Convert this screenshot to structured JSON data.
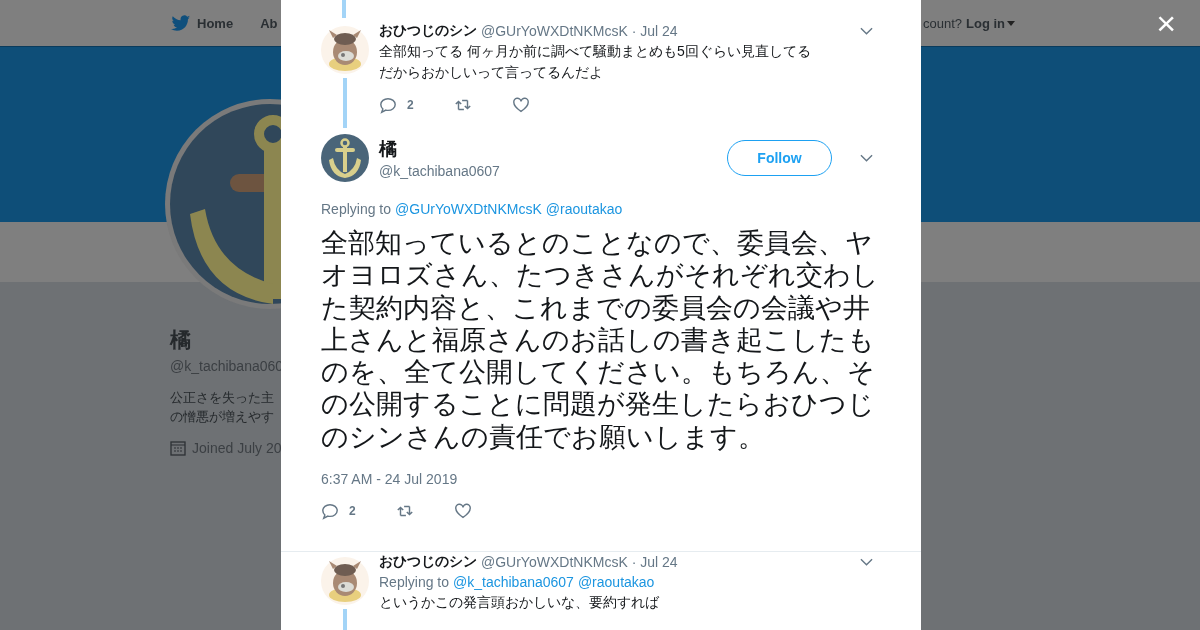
{
  "background_page": {
    "nav": {
      "home": "Home",
      "about": "Ab",
      "account_prompt": "count?",
      "login": "Log in"
    },
    "profile": {
      "name": "橘",
      "handle": "@k_tachibana060",
      "bio": [
        "公正さを失った主",
        "の憎悪が増えやす"
      ],
      "joined": "Joined July 20"
    }
  },
  "modal": {
    "close": "×",
    "tweets": [
      {
        "kind": "reply",
        "author": "おひつじのシン",
        "handle": "@GUrYoWXDtNKMcsK",
        "date": "· Jul 24",
        "lines": [
          "全部知ってる 何ヶ月か前に調べて騒動まとめも5回ぐらい見直してる",
          "だからおかしいって言ってるんだよ"
        ],
        "reply_count": "2"
      },
      {
        "kind": "main",
        "author": "橘",
        "handle": "@k_tachibana0607",
        "follow": "Follow",
        "replying_label": "Replying to",
        "replying_to": [
          "@GUrYoWXDtNKMcsK",
          "@raoutakao"
        ],
        "text": "全部知っているとのことなので、委員会、ヤオヨロズさん、たつきさんがそれぞれ交わした契約内容と、これまでの委員会の会議や井上さんと福原さんのお話しの書き起こしたものを、全て公開してください。もちろん、その公開することに問題が発生したらおひつじのシンさんの責任でお願いします。",
        "timestamp": "6:37 AM - 24 Jul 2019",
        "reply_count": "2"
      },
      {
        "kind": "reply",
        "author": "おひつじのシン",
        "handle": "@GUrYoWXDtNKMcsK",
        "date": "· Jul 24",
        "replying_label": "Replying to",
        "replying_to": [
          "@k_tachibana0607",
          "@raoutakao"
        ],
        "lines": [
          "というかこの発言頭おかしいな、要約すれば"
        ]
      }
    ]
  }
}
